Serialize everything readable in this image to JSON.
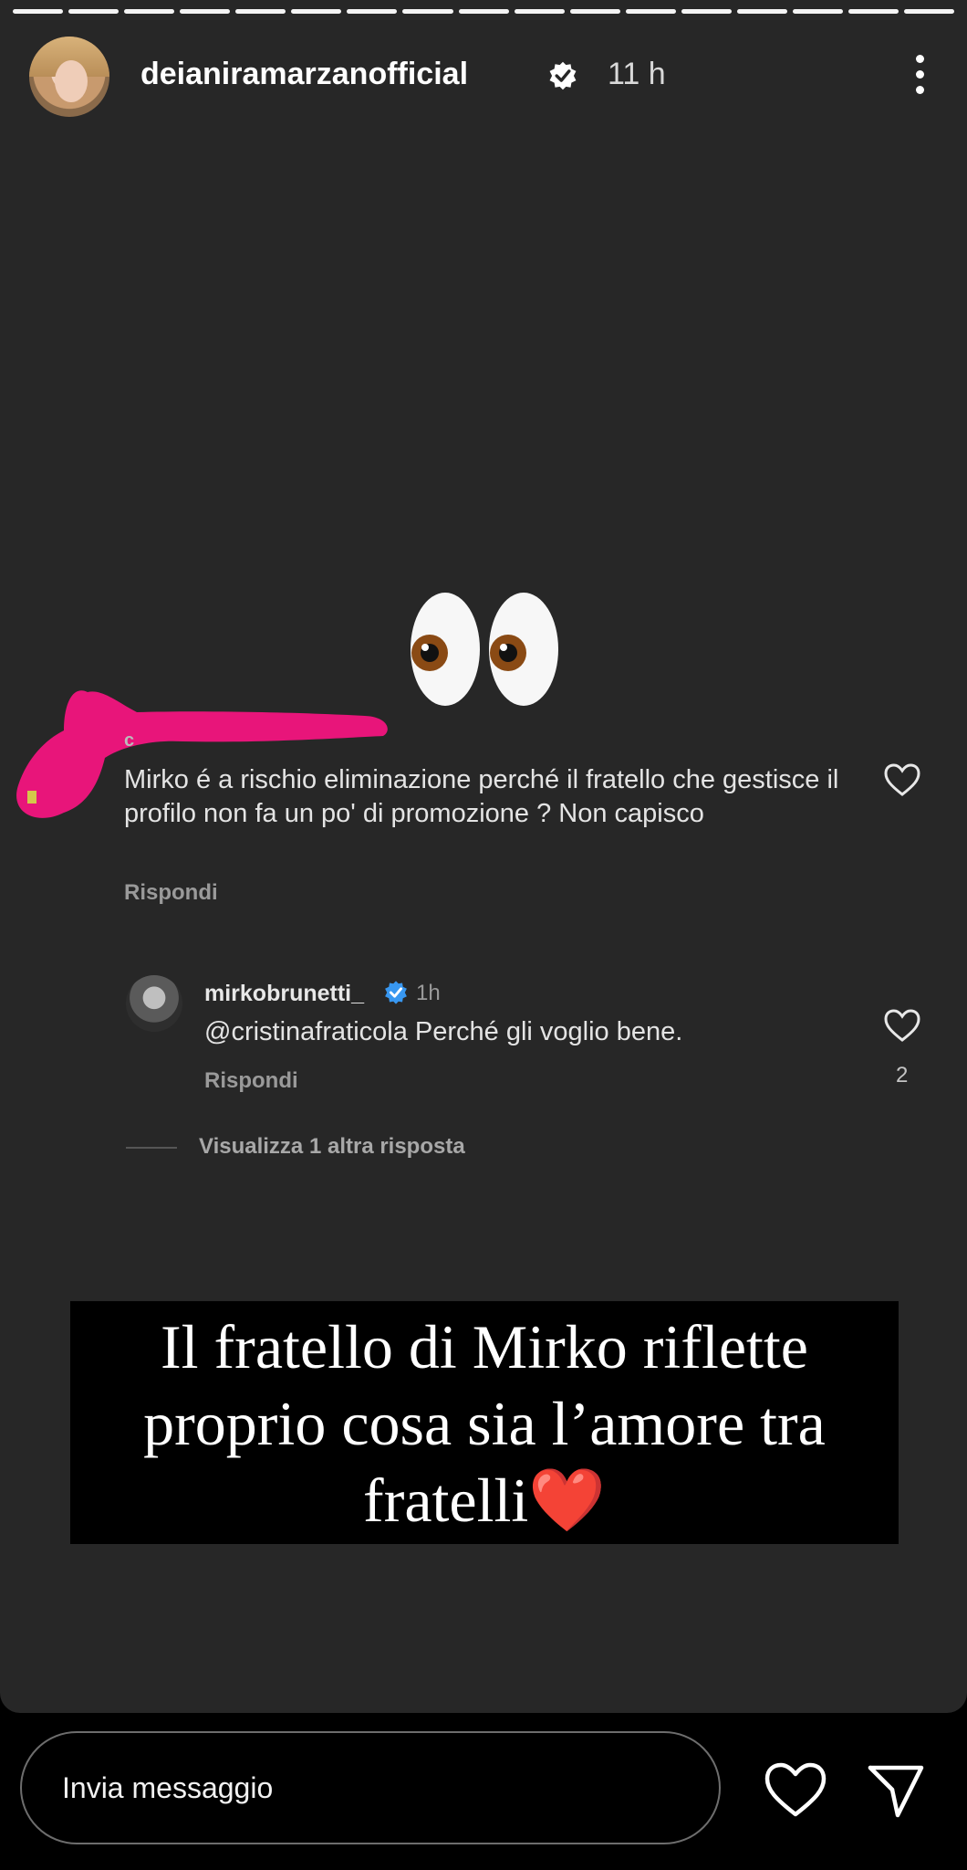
{
  "story": {
    "progress_segments": 17,
    "username": "deianiramarzanofficial",
    "time": "11 h",
    "icons": {
      "verified": "verified-badge-icon",
      "more": "more-options-icon",
      "reaction": "eyes-emoji-icon"
    }
  },
  "comment": {
    "author_initial": "c",
    "text": "Mirko é a rischio eliminazione perché il fratello che gestisce il profilo non fa un po' di promozione ? Non capisco",
    "reply_label": "Rispondi"
  },
  "reply": {
    "username": "mirkobrunetti_",
    "time": "1h",
    "text": "@cristinafraticola Perché gli voglio bene.",
    "reply_label": "Rispondi",
    "likes": "2",
    "more_replies": "Visualizza 1 altra risposta"
  },
  "caption": {
    "line1": "Il fratello di Mirko riflette",
    "line2": "proprio cosa sia l’amore tra",
    "line3": "fratelli❤️"
  },
  "bottom": {
    "placeholder": "Invia messaggio",
    "icons": {
      "like": "heart-icon",
      "send": "send-icon"
    }
  },
  "colors": {
    "story_bg": "#272727",
    "highlight": "#e8157a",
    "verified": "#3897f0"
  }
}
